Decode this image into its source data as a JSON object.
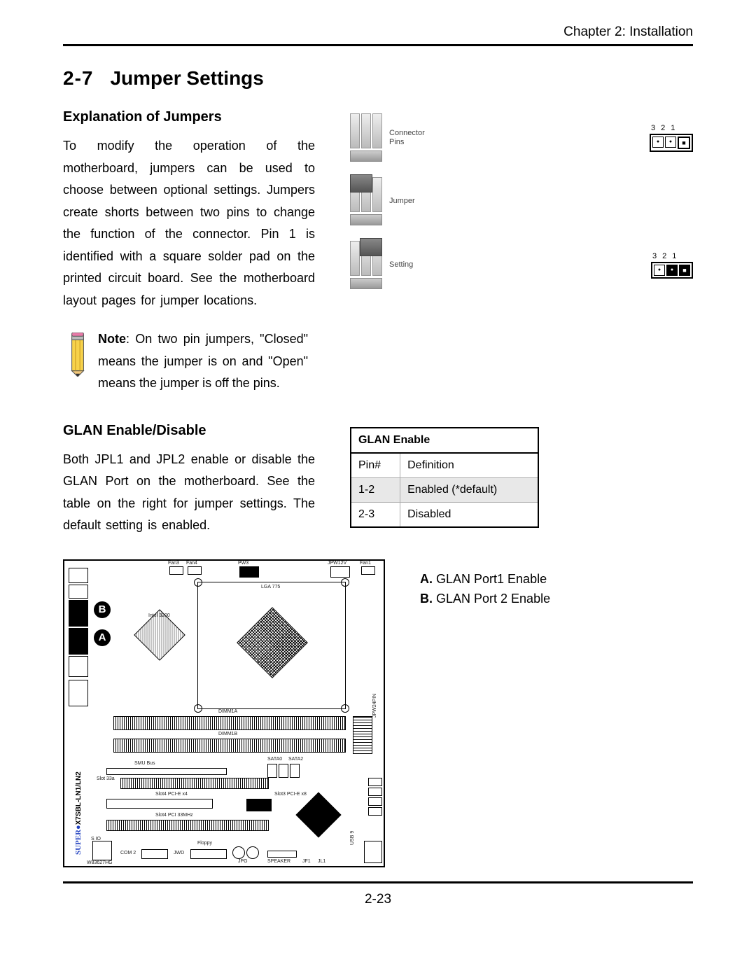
{
  "header": {
    "chapter": "Chapter 2: Installation"
  },
  "section": {
    "number": "2-7",
    "title": "Jumper Settings"
  },
  "explanation": {
    "heading": "Explanation of Jumpers",
    "body": "To modify the operation of the motherboard, jumpers can be used to choose between optional settings. Jumpers create shorts between two pins to change the function of the connector. Pin 1 is identified with a square solder pad on the printed circuit board. See the motherboard layout pages for jumper locations.",
    "note_label": "Note",
    "note_body": ": On two pin jumpers, \"Closed\" means the jumper is on and \"Open\" means the jumper is off the pins."
  },
  "jumper_diagram": {
    "connector_label": "Connector\nPins",
    "jumper_label": "Jumper",
    "setting_label": "Setting",
    "pin_numbers": [
      "3",
      "2",
      "1"
    ]
  },
  "glan": {
    "heading": "GLAN Enable/Disable",
    "body": "Both JPL1 and JPL2 enable or disable the GLAN Port on the motherboard. See the table on the right for jumper settings. The default setting is enabled.",
    "table_title": "GLAN Enable",
    "cols": [
      "Pin#",
      "Definition"
    ],
    "rows": [
      {
        "pin": "1-2",
        "def": "Enabled (*default)"
      },
      {
        "pin": "2-3",
        "def": "Disabled"
      }
    ]
  },
  "callouts": {
    "a_label": "A.",
    "a_text": " GLAN Port1 Enable",
    "b_label": "B.",
    "b_text": " GLAN Port 2 Enable"
  },
  "mobo": {
    "brand": "SUPER●",
    "model": "X7SBL-LN1/LN2",
    "markerA": "A",
    "markerB": "B",
    "lga": "LGA 775",
    "intel_chip": "Intel 3200",
    "dimm1a": "DIMM1A",
    "dimm1b": "DIMM1B",
    "smbus": "SMU Bus",
    "slot33a": "Slot 33a",
    "slot_pcie4": "Slot4 PCI-E x4",
    "slot_pcie8": "Slot3 PCI-E x8",
    "slot_pci": "Slot4 PCI 33MHz",
    "com2": "COM 2",
    "sio": "S IO",
    "w83627": "W83627HG",
    "floppy": "Floppy",
    "fan3": "Fan3",
    "fan4": "Fan4",
    "jpg": "JPG",
    "jwd": "JWD",
    "speaker": "SPEAKER",
    "jf1": "JF1",
    "jl1": "JL1",
    "usb9": "USB 9",
    "fan1": "Fan1",
    "pw3": "PW3",
    "jpw12v": "JPW12V",
    "sata0": "SATA0",
    "sata2": "SATA2",
    "pwr": "JPW24PIN"
  },
  "page_number": "2-23"
}
